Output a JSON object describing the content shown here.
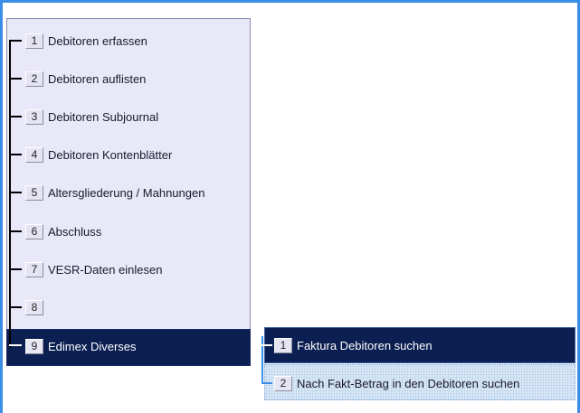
{
  "menu": {
    "items": [
      {
        "num": "1",
        "label": "Debitoren erfassen"
      },
      {
        "num": "2",
        "label": "Debitoren auflisten"
      },
      {
        "num": "3",
        "label": "Debitoren Subjournal"
      },
      {
        "num": "4",
        "label": "Debitoren Kontenblätter"
      },
      {
        "num": "5",
        "label": "Altersgliederung / Mahnungen"
      },
      {
        "num": "6",
        "label": "Abschluss"
      },
      {
        "num": "7",
        "label": "VESR-Daten einlesen"
      },
      {
        "num": "8",
        "label": ""
      },
      {
        "num": "9",
        "label": "Edimex Diverses"
      }
    ],
    "selected_index": 8
  },
  "submenu": {
    "items": [
      {
        "num": "1",
        "label": "Faktura Debitoren suchen"
      },
      {
        "num": "2",
        "label": "Nach Fakt-Betrag in den Debitoren suchen"
      }
    ],
    "selected_index": 0,
    "focused_index": 1
  },
  "colors": {
    "accent": "#3a8ee6",
    "selected_bg": "#0b1f52",
    "panel_bg": "#e8e8f8"
  }
}
